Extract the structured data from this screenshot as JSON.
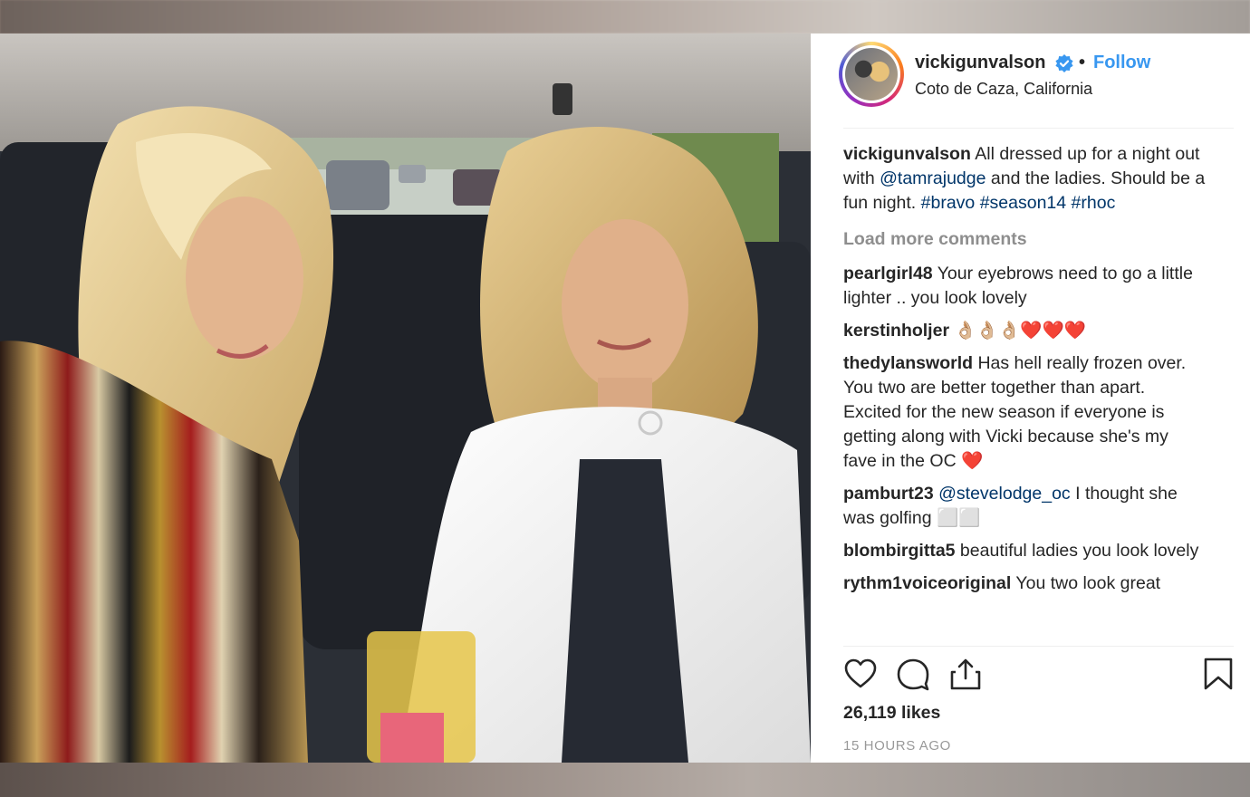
{
  "post": {
    "username": "vickigunvalson",
    "follow_label": "Follow",
    "separator": "•",
    "location": "Coto de Caza, California"
  },
  "caption": {
    "username": "vickigunvalson",
    "text_1": " All dressed up for a night out with ",
    "mention": "@tamrajudge",
    "text_2": " and the ladies. Should be a fun night. ",
    "hashtags": [
      "#bravo",
      "#season14",
      "#rhoc"
    ]
  },
  "load_more_label": "Load more comments",
  "comments": [
    {
      "username": "pearlgirl48",
      "text": " Your eyebrows need to go a little lighter .. you look lovely"
    },
    {
      "username": "kerstinholjer",
      "text": " 👌🏼👌🏼👌🏼❤️❤️❤️"
    },
    {
      "username": "thedylansworld",
      "text": " Has hell really frozen over. You two are better together than apart. Excited for the new season if everyone is getting along with Vicki because she's my fave in the OC ❤️"
    },
    {
      "username": "pamburt23",
      "mention": "@stevelodge_oc",
      "text": " I thought she was golfing ⬜⬜"
    },
    {
      "username": "blombirgitta5",
      "text": " beautiful ladies you look lovely"
    },
    {
      "username": "rythm1voiceoriginal",
      "text": " You two look great"
    }
  ],
  "likes_text": "26,119 likes",
  "time_ago": "15 HOURS AGO",
  "icons": {
    "verified": "verified-badge-icon",
    "like": "heart-icon",
    "comment": "comment-bubble-icon",
    "share": "share-icon",
    "save": "bookmark-icon"
  },
  "colors": {
    "follow": "#3897f0",
    "link": "#003569",
    "muted": "#8e8e8e",
    "text": "#262626"
  }
}
